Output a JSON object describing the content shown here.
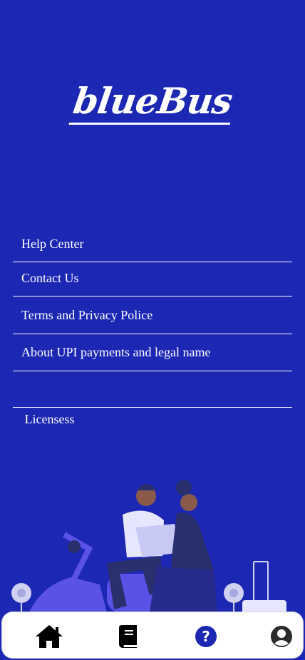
{
  "app": {
    "logo_text": "blueBus"
  },
  "menu": {
    "items": [
      {
        "label": "Help Center"
      },
      {
        "label": "Contact Us"
      },
      {
        "label": "Terms and Privacy Police"
      },
      {
        "label": "About UPI payments and legal name"
      },
      {
        "label": " Licensess"
      }
    ]
  },
  "bottom_nav": {
    "items": [
      {
        "icon": "home-icon",
        "active": false
      },
      {
        "icon": "book-icon",
        "active": false
      },
      {
        "icon": "help-icon",
        "active": true
      },
      {
        "icon": "account-icon",
        "active": false
      }
    ]
  },
  "colors": {
    "background": "#1c27b3",
    "text": "#ffffff",
    "nav_background": "#ffffff",
    "active_icon": "#1c27b3",
    "inactive_icon": "#000000",
    "illustration_accent": "#5a52e6"
  }
}
